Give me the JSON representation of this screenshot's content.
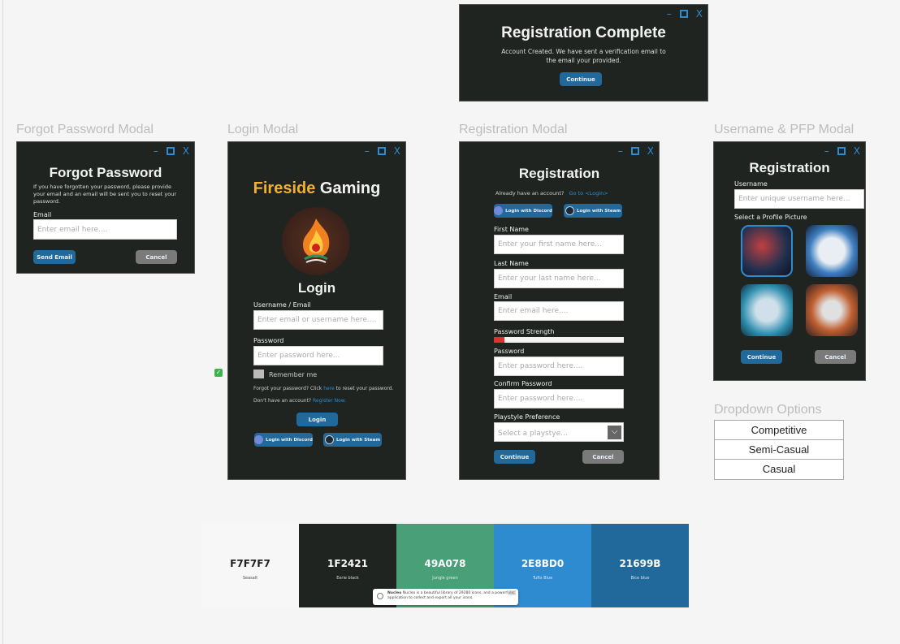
{
  "window_controls": {
    "minimize": "–",
    "close": "X"
  },
  "registration_complete": {
    "title": "Registration Complete",
    "message": "Account Created. We have sent a verification email to the email your provided.",
    "continue": "Continue"
  },
  "forgot": {
    "frame_label": "Forgot Password Modal",
    "title": "Forgot Password",
    "message": "If you have forgotten your password, please provide your email and an email will be sent you to reset your password.",
    "email_label": "Email",
    "email_placeholder": "Enter email here....",
    "send": "Send Email",
    "cancel": "Cancel"
  },
  "login": {
    "frame_label": "Login Modal",
    "brand_highlight": "Fireside",
    "brand_rest": "Gaming",
    "title": "Login",
    "user_label": "Username / Email",
    "user_placeholder": "Enter email or username here....",
    "pass_label": "Password",
    "pass_placeholder": "Enter password here...",
    "remember": "Remember me",
    "forgot_pre": "Forgot your password? Click ",
    "forgot_link": "here",
    "forgot_post": " to reset your password.",
    "register_pre": "Don't have an account? ",
    "register_link": "Register Now.",
    "login_btn": "Login",
    "discord": "Login with Discord",
    "steam": "Login with Steam"
  },
  "registration": {
    "frame_label": "Registration Modal",
    "title": "Registration",
    "have_account": "Already have an account?",
    "goto_login": "Go to <Login>",
    "discord": "Login with Discord",
    "steam": "Login with Steam",
    "first_label": "First Name",
    "first_placeholder": "Enter your first name here...",
    "last_label": "Last Name",
    "last_placeholder": "Enter your last name here...",
    "email_label": "Email",
    "email_placeholder": "Enter email here....",
    "strength_label": "Password Strength",
    "strength_percent": 8,
    "pass_label": "Password",
    "pass_placeholder": "Enter password here....",
    "confirm_label": "Confirm Password",
    "confirm_placeholder": "Enter password here....",
    "playstyle_label": "Playstyle Preference",
    "playstyle_placeholder": "Select a playstye...",
    "continue": "Continue",
    "cancel": "Cancel"
  },
  "pfp": {
    "frame_label": "Username & PFP Modal",
    "title": "Registration",
    "username_label": "Username",
    "username_placeholder": "Enter unique username here...",
    "select_label": "Select a Profile Picture",
    "continue": "Continue",
    "cancel": "Cancel"
  },
  "dropdown": {
    "frame_label": "Dropdown Options",
    "options": [
      "Competitive",
      "Semi-Casual",
      "Casual"
    ]
  },
  "palette": [
    {
      "hex": "F7F7F7",
      "name": "Seasalt",
      "color": "#F7F7F7",
      "text": "#222222"
    },
    {
      "hex": "1F2421",
      "name": "Eerie black",
      "color": "#1F2421",
      "text": "#ffffff"
    },
    {
      "hex": "49A078",
      "name": "Jungle green",
      "color": "#49A078",
      "text": "#ffffff"
    },
    {
      "hex": "2E8BD0",
      "name": "Tufts Blue",
      "color": "#2E8BD0",
      "text": "#ffffff"
    },
    {
      "hex": "21699B",
      "name": "Bice blue",
      "color": "#21699B",
      "text": "#ffffff"
    }
  ],
  "toast": {
    "app": "Nucleo",
    "message": "Nucleo is a beautiful library of 29280 icons, and a powerful application to collect and export all your icons.",
    "badge": "ESC"
  }
}
